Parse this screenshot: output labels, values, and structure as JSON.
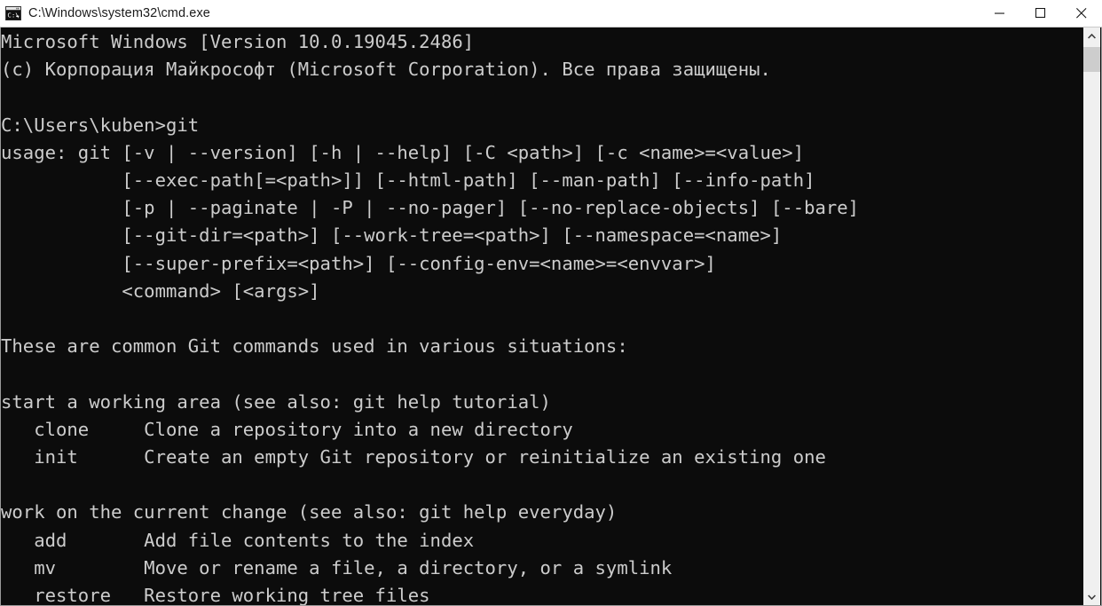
{
  "window": {
    "title": "C:\\Windows\\system32\\cmd.exe",
    "icon": "cmd-console-icon",
    "background_color": "#0c0c0c",
    "foreground_color": "#cccccc",
    "titlebar_color": "#ffffff",
    "controls": {
      "minimize_label": "Minimize",
      "maximize_label": "Maximize",
      "close_label": "Close"
    }
  },
  "scrollbar": {
    "up_arrow_label": "Scroll up",
    "down_arrow_label": "Scroll down",
    "thumb_label": "Scroll thumb"
  },
  "console": {
    "lines": [
      "Microsoft Windows [Version 10.0.19045.2486]",
      "(c) Корпорация Майкрософт (Microsoft Corporation). Все права защищены.",
      "",
      "C:\\Users\\kuben>git",
      "usage: git [-v | --version] [-h | --help] [-C <path>] [-c <name>=<value>]",
      "           [--exec-path[=<path>]] [--html-path] [--man-path] [--info-path]",
      "           [-p | --paginate | -P | --no-pager] [--no-replace-objects] [--bare]",
      "           [--git-dir=<path>] [--work-tree=<path>] [--namespace=<name>]",
      "           [--super-prefix=<path>] [--config-env=<name>=<envvar>]",
      "           <command> [<args>]",
      "",
      "These are common Git commands used in various situations:",
      "",
      "start a working area (see also: git help tutorial)",
      "   clone     Clone a repository into a new directory",
      "   init      Create an empty Git repository or reinitialize an existing one",
      "",
      "work on the current change (see also: git help everyday)",
      "   add       Add file contents to the index",
      "   mv        Move or rename a file, a directory, or a symlink",
      "   restore   Restore working tree files"
    ],
    "prompt": "C:\\Users\\kuben>",
    "command_entered": "git",
    "os_version": "10.0.19045.2486",
    "copyright": "(c) Корпорация Майкрософт (Microsoft Corporation). Все права защищены.",
    "section_headers": [
      "These are common Git commands used in various situations:",
      "start a working area (see also: git help tutorial)",
      "work on the current change (see also: git help everyday)"
    ],
    "commands": [
      {
        "name": "clone",
        "description": "Clone a repository into a new directory"
      },
      {
        "name": "init",
        "description": "Create an empty Git repository or reinitialize an existing one"
      },
      {
        "name": "add",
        "description": "Add file contents to the index"
      },
      {
        "name": "mv",
        "description": "Move or rename a file, a directory, or a symlink"
      },
      {
        "name": "restore",
        "description": "Restore working tree files"
      }
    ]
  }
}
